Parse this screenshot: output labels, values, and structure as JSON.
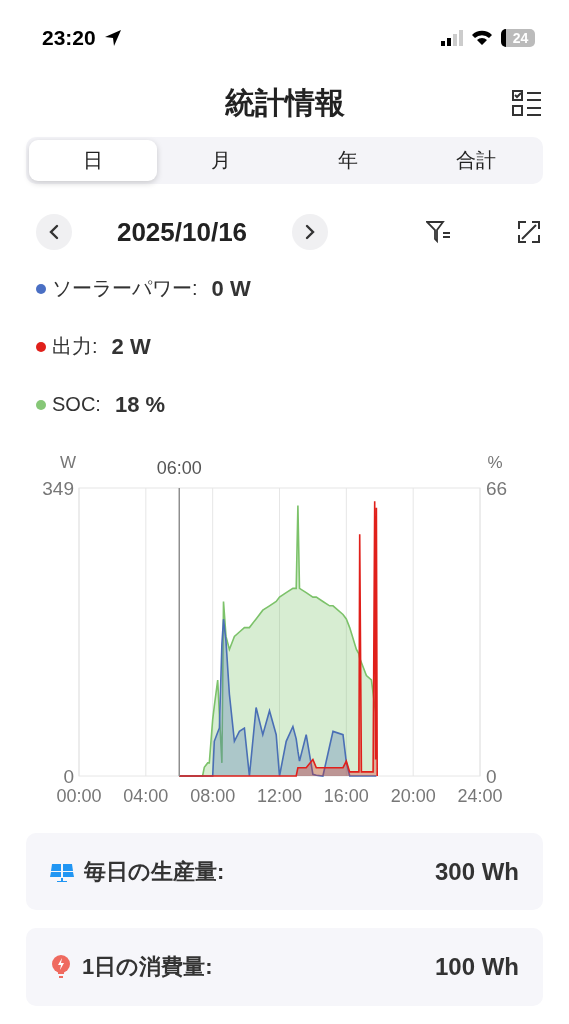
{
  "status_bar": {
    "time": "23:20",
    "battery": "24"
  },
  "header": {
    "title": "統計情報"
  },
  "tabs": [
    {
      "label": "日",
      "selected": true
    },
    {
      "label": "月",
      "selected": false
    },
    {
      "label": "年",
      "selected": false
    },
    {
      "label": "合計",
      "selected": false
    }
  ],
  "date_nav": {
    "date": "2025/10/16"
  },
  "legend": [
    {
      "label": "ソーラーパワー:",
      "value": "0 W",
      "color": "#4a6fc4"
    },
    {
      "label": "出力:",
      "value": "2 W",
      "color": "#e0201b"
    },
    {
      "label": "SOC:",
      "value": "18 %",
      "color": "#86c777"
    }
  ],
  "chart": {
    "chart_data": {
      "type": "area",
      "ylabel": "W",
      "y2label": "%",
      "ylim": [
        0,
        349
      ],
      "yticks": [
        0,
        349
      ],
      "y2lim": [
        0,
        66
      ],
      "y2ticks": [
        0,
        66
      ],
      "xlim": [
        0,
        24
      ],
      "xticks": [
        {
          "value": 0,
          "label": "00:00"
        },
        {
          "value": 4,
          "label": "04:00"
        },
        {
          "value": 8,
          "label": "08:00"
        },
        {
          "value": 12,
          "label": "12:00"
        },
        {
          "value": 16,
          "label": "16:00"
        },
        {
          "value": 20,
          "label": "20:00"
        },
        {
          "value": 24,
          "label": "24:00"
        }
      ],
      "annotations": [
        {
          "x": 6,
          "text": "06:00"
        }
      ],
      "grid": true,
      "stacked": false,
      "x": [
        6,
        7.4,
        7.5,
        7.7,
        7.8,
        8,
        8.1,
        8.3,
        8.4,
        8.55,
        8.65,
        8.8,
        9,
        9.3,
        9.6,
        9.9,
        10.2,
        10.6,
        11,
        11.4,
        11.8,
        12,
        12.4,
        12.8,
        13,
        13.1,
        13.2,
        13.6,
        14,
        14.2,
        14.6,
        15,
        15.2,
        15.8,
        16,
        16.2,
        16.6,
        16.75,
        16.8,
        16.9,
        17.2,
        17.5,
        17.6,
        17.7,
        17.75,
        17.8,
        17.85
      ],
      "series": [
        {
          "color": "#7cc26a",
          "axis": "y2",
          "values": [
            0,
            0,
            2,
            3,
            3,
            13,
            16,
            22,
            14,
            3,
            40,
            32,
            29,
            32,
            33,
            34,
            34,
            36,
            38,
            39,
            40,
            41,
            42,
            43,
            43,
            62,
            43,
            42,
            41,
            41,
            40,
            39,
            39,
            37,
            36,
            34,
            29,
            28,
            27,
            26,
            23,
            22,
            19,
            16,
            15,
            13,
            null
          ]
        },
        {
          "color": "#4a6fb5",
          "values": [
            0,
            0,
            0,
            0,
            0,
            0,
            42,
            53,
            58,
            160,
            190,
            163,
            99,
            42,
            54,
            58,
            0,
            83,
            50,
            79,
            50,
            0,
            42,
            60,
            45,
            30,
            18,
            50,
            2,
            1,
            0,
            36,
            54,
            50,
            17,
            0,
            0,
            0,
            0,
            0,
            0,
            0,
            0,
            0,
            0,
            0,
            null
          ]
        },
        {
          "color": "#e0201b",
          "values": [
            0,
            0,
            0,
            0,
            0,
            0,
            0,
            0,
            0,
            0,
            0,
            0,
            0,
            0,
            0,
            0,
            0,
            0,
            0,
            0,
            0,
            0,
            0,
            0,
            0,
            10,
            10,
            10,
            20,
            10,
            10,
            10,
            10,
            10,
            18,
            5,
            5,
            5,
            293,
            5,
            5,
            5,
            5,
            333,
            20,
            325,
            0
          ]
        }
      ]
    }
  },
  "summary": [
    {
      "kind": "production",
      "label": "毎日の生産量:",
      "value": "300 Wh"
    },
    {
      "kind": "consumption",
      "label": "1日の消費量:",
      "value": "100 Wh"
    }
  ]
}
